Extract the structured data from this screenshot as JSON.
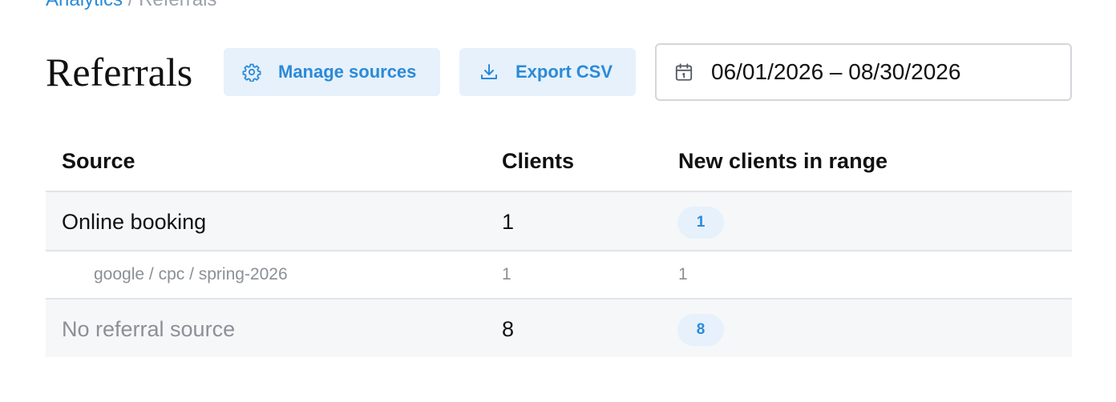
{
  "breadcrumb": {
    "parent": "Analytics",
    "separator": " / ",
    "current": "Referrals"
  },
  "page": {
    "title": "Referrals"
  },
  "toolbar": {
    "manage_sources_label": "Manage sources",
    "export_csv_label": "Export CSV",
    "date_range": "06/01/2026 – 08/30/2026"
  },
  "icons": {
    "manage_sources": "gear-icon",
    "export_csv": "download-icon",
    "date_range": "calendar-icon"
  },
  "colors": {
    "accent": "#2b8ad8",
    "accent_bg": "#e6f1fb",
    "muted_text": "#8a9096",
    "row_bg": "#f6f7f8"
  },
  "table": {
    "headers": {
      "source": "Source",
      "clients": "Clients",
      "new_clients": "New clients in range"
    },
    "rows": [
      {
        "source": "Online booking",
        "clients": "1",
        "new_clients": "1"
      },
      {
        "source": "google / cpc / spring-2026",
        "clients": "1",
        "new_clients": "1"
      },
      {
        "source": "No referral source",
        "clients": "8",
        "new_clients": "8"
      }
    ]
  }
}
